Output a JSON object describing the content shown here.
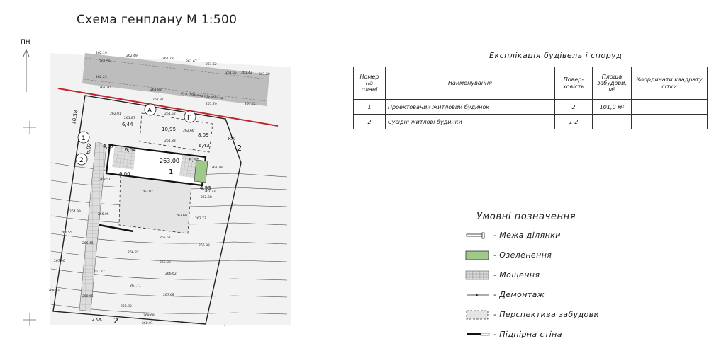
{
  "title": "Схема генплану М 1:500",
  "north_label": "ПН",
  "plan": {
    "street_label": "вул. Романа Шухевича",
    "building_number": "1",
    "building_elevation": "263,00",
    "zone_labels": [
      "2",
      "2"
    ],
    "axis_markers": [
      "А",
      "Г",
      "1",
      "2"
    ],
    "dimensions": [
      "6,44",
      "10,95",
      "8,09",
      "6,43",
      "4,67",
      "6,04",
      "6,00",
      "6,65",
      "4,93",
      "10,58",
      "6,02"
    ],
    "spot_elevations": [
      "262.19",
      "262.49",
      "261.73",
      "261.67",
      "261.62",
      "262.58",
      "262.23",
      "261.65",
      "261.42",
      "261.20",
      "262.20",
      "261.83",
      "261.81",
      "261.52",
      "261.42",
      "262.01",
      "261.87",
      "261.70",
      "262.66",
      "261.83",
      "261.79",
      "263.57",
      "262.33",
      "263.02",
      "262.28",
      "264.99",
      "265.95",
      "263.60",
      "263.73",
      "265.57",
      "266.55",
      "266.45",
      "266.32",
      "266.38",
      "267.90",
      "266.98",
      "267.72",
      "266.62",
      "267.71",
      "267.68",
      "268.93",
      "268.65",
      "268.80",
      "268.68",
      "268.91"
    ],
    "fence_labels": [
      "КЖ",
      "2 КЖ"
    ]
  },
  "explication": {
    "title": "Експлікація будівель і споруд",
    "headers": [
      "Номер на плані",
      "Найменування",
      "Поверховість",
      "Площа забудови, м²",
      "Координати квадрату сітки"
    ],
    "header_display": [
      "Номер на\nплані",
      "Найменування",
      "Повер-\nховість",
      "Площа\nзабудови,\nм²",
      "Координати квадрату\nсітки"
    ],
    "rows": [
      {
        "number": "1",
        "name": "Проектований житловий будинок",
        "floors": "2",
        "area": "101,0 м²",
        "coords": ""
      },
      {
        "number": "2",
        "name": "Сусідні житлові будинки",
        "floors": "1-2",
        "area": "",
        "coords": ""
      }
    ]
  },
  "legend": {
    "title": "Умовні позначення",
    "items": [
      {
        "key": "boundary",
        "label": "- Межа ділянки"
      },
      {
        "key": "greening",
        "label": "- Озеленення"
      },
      {
        "key": "paving",
        "label": "- Мощення"
      },
      {
        "key": "demolition",
        "label": "- Демонтаж"
      },
      {
        "key": "future",
        "label": "- Перспектива забудови"
      },
      {
        "key": "wall",
        "label": "- Підпірна стіна"
      }
    ]
  },
  "colors": {
    "greening": "#9fc98a",
    "paving": "#d6d6d6",
    "road": "#bdbdbd",
    "red_line": "#c0262d",
    "terrain": "#e8e8e8"
  }
}
